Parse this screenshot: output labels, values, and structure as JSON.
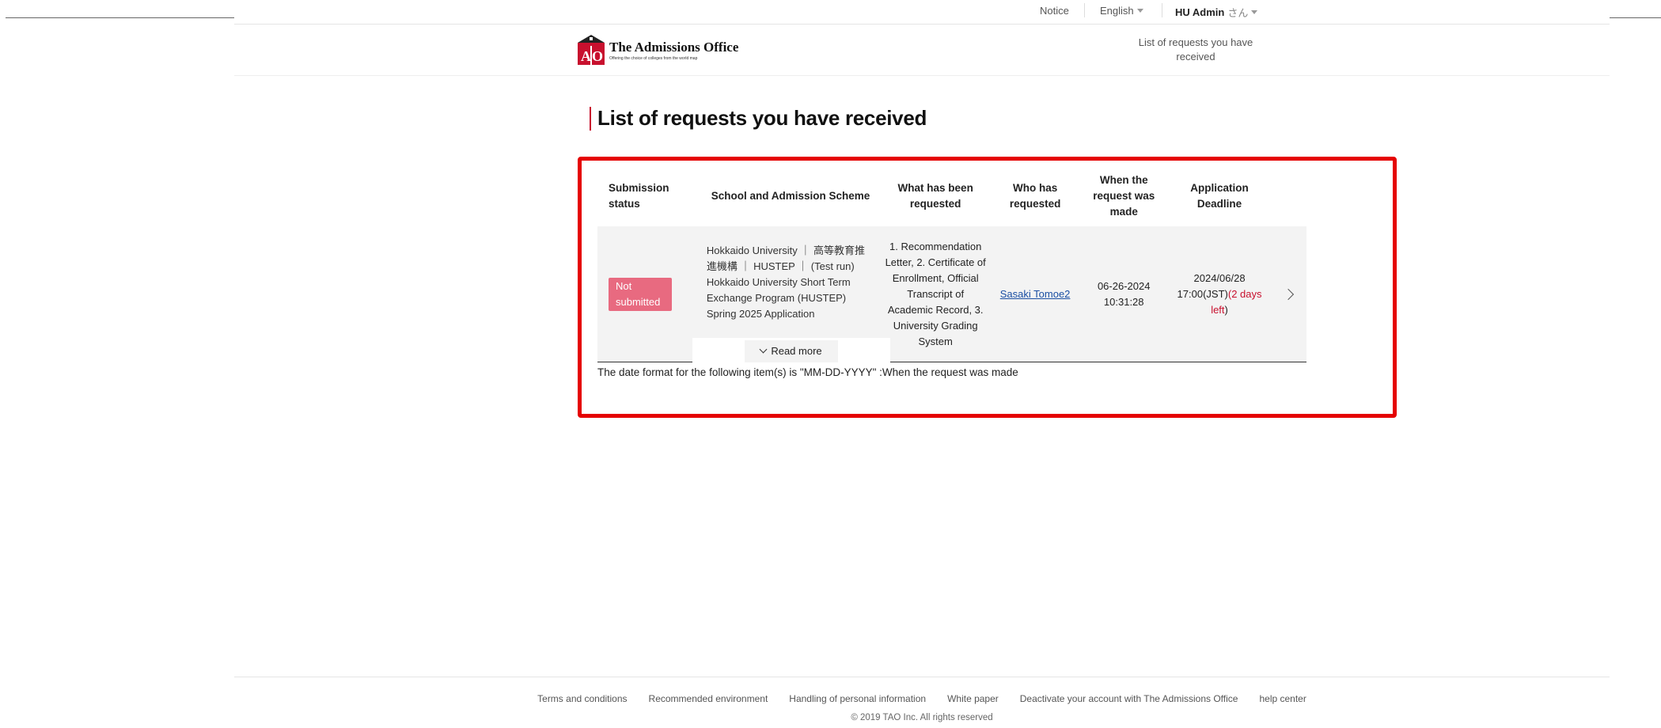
{
  "topnav": {
    "notice": "Notice",
    "language": "English",
    "user_name": "HU Admin",
    "user_suffix": "さん"
  },
  "header": {
    "logo_title": "The Admissions Office",
    "logo_subtitle": "Offering the choice of colleges from the world map",
    "nav_link": "List of requests you have received"
  },
  "main": {
    "page_title": "List of requests you have received",
    "table": {
      "headers": [
        "Submission status",
        "School and Admission Scheme",
        "What has been requested",
        "Who has requested",
        "When the request was made",
        "Application Deadline"
      ],
      "rows": [
        {
          "status": "Not submitted",
          "scheme": "Hokkaido University ｜ 高等教育推進機構 ｜ HUSTEP ｜ (Test run) Hokkaido University Short Term Exchange Program (HUSTEP) Spring 2025 Application",
          "read_more": "Read more",
          "requested_items": "1. Recommendation Letter, 2. Certificate of Enrollment, Official Transcript of Academic Record, 3. University Grading System",
          "requester": "Sasaki Tomoe2",
          "request_date": "06-26-2024 10:31:28",
          "deadline": "2024/06/28 17:00(JST)",
          "deadline_open": "(",
          "days_left": "2 days left",
          "deadline_close": ")"
        }
      ]
    },
    "date_note": "The date format for the following item(s) is \"MM-DD-YYYY\" :When the request was made"
  },
  "footer": {
    "links": [
      "Terms and conditions",
      "Recommended environment",
      "Handling of personal information",
      "White paper",
      "Deactivate your account with The Admissions Office",
      "help center"
    ],
    "copyright": "© 2019 TAO Inc. All rights reserved"
  },
  "colors": {
    "accent": "#c8102e",
    "badge": "#e86a80",
    "highlight_border": "#e50000",
    "link": "#1a4fa3"
  }
}
